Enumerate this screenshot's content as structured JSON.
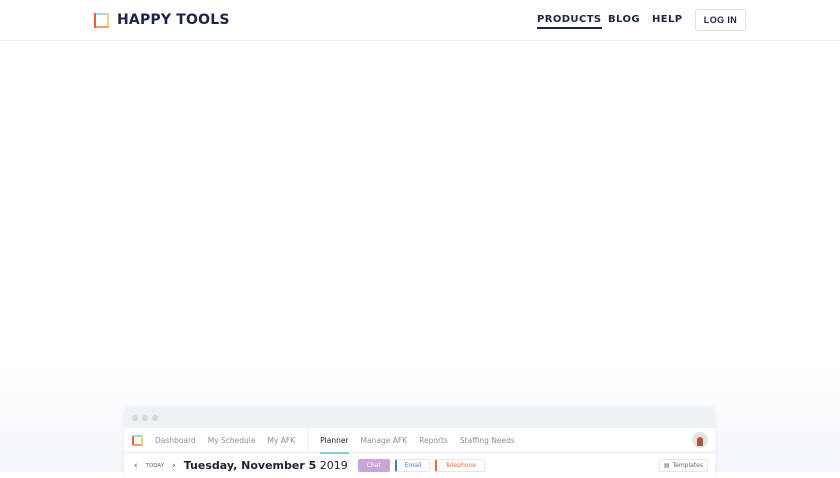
{
  "header": {
    "brand": "HAPPY TOOLS",
    "nav": [
      {
        "label": "PRODUCTS",
        "active": true
      },
      {
        "label": "BLOG"
      },
      {
        "label": "HELP"
      }
    ],
    "login": "LOG IN"
  },
  "app": {
    "nav": {
      "left": [
        "Dashboard",
        "My Schedule",
        "My AFK"
      ],
      "right": [
        "Planner",
        "Manage AFK",
        "Reports",
        "Staffing Needs"
      ]
    },
    "toolbar": {
      "today": "TODAY",
      "date_main": "Tuesday, November 5",
      "date_year": "2019",
      "chips": [
        "Chat",
        "Email",
        "Telephone"
      ],
      "templates": "Templates"
    }
  }
}
